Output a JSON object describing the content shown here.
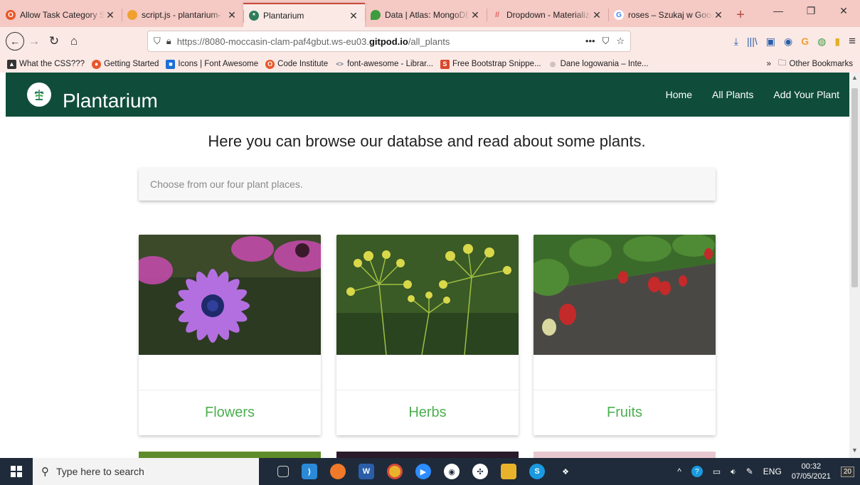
{
  "browser": {
    "tabs": [
      {
        "title": "Allow Task Category S",
        "color": "#e8572a",
        "glyph": "O",
        "active": false
      },
      {
        "title": "script.js - plantarium-",
        "color": "#f0a030",
        "glyph": "",
        "active": false
      },
      {
        "title": "Plantarium",
        "color": "#2e7d5b",
        "glyph": "*",
        "active": true
      },
      {
        "title": "Data | Atlas: MongoDB",
        "color": "#3f9b3f",
        "glyph": "",
        "active": false
      },
      {
        "title": "Dropdown - Materialize",
        "color": "#e25c5c",
        "glyph": "//",
        "active": false
      },
      {
        "title": "roses – Szukaj w Google",
        "color": "#4285f4",
        "glyph": "G",
        "active": false
      }
    ],
    "url_prefix": "https://8080-moccasin-clam-paf4gbut.ws-eu03.",
    "url_host": "gitpod.io",
    "url_path": "/all_plants",
    "bookmarks": [
      {
        "label": "What the CSS???",
        "color": "#333333",
        "glyph": "▲"
      },
      {
        "label": "Getting Started",
        "color": "#e8572a",
        "glyph": "●"
      },
      {
        "label": "Icons | Font Awesome",
        "color": "#1c6fd8",
        "glyph": "■"
      },
      {
        "label": "Code Institute",
        "color": "#e8572a",
        "glyph": "O"
      },
      {
        "label": "font-awesome - Librar...",
        "color": "#6b7b8c",
        "glyph": "<>"
      },
      {
        "label": "Free Bootstrap Snippe...",
        "color": "#d9482b",
        "glyph": "S"
      },
      {
        "label": "Dane logowania – Inte...",
        "color": "#666666",
        "glyph": "◎"
      }
    ],
    "other_bookmarks": "Other Bookmarks"
  },
  "site": {
    "brand": "Plantarium",
    "menu": [
      "Home",
      "All Plants",
      "Add Your Plant"
    ],
    "intro": "Here you can browse our databse and read about some plants.",
    "select_placeholder": "Choose from our four plant places.",
    "cards": [
      {
        "title": "Flowers"
      },
      {
        "title": "Herbs"
      },
      {
        "title": "Fruits"
      }
    ],
    "accent_color": "#4caf50",
    "nav_color": "#0f4d3a"
  },
  "taskbar": {
    "search_placeholder": "Type here to search",
    "lang": "ENG",
    "time": "00:32",
    "date": "07/05/2021",
    "notifications": "20"
  }
}
